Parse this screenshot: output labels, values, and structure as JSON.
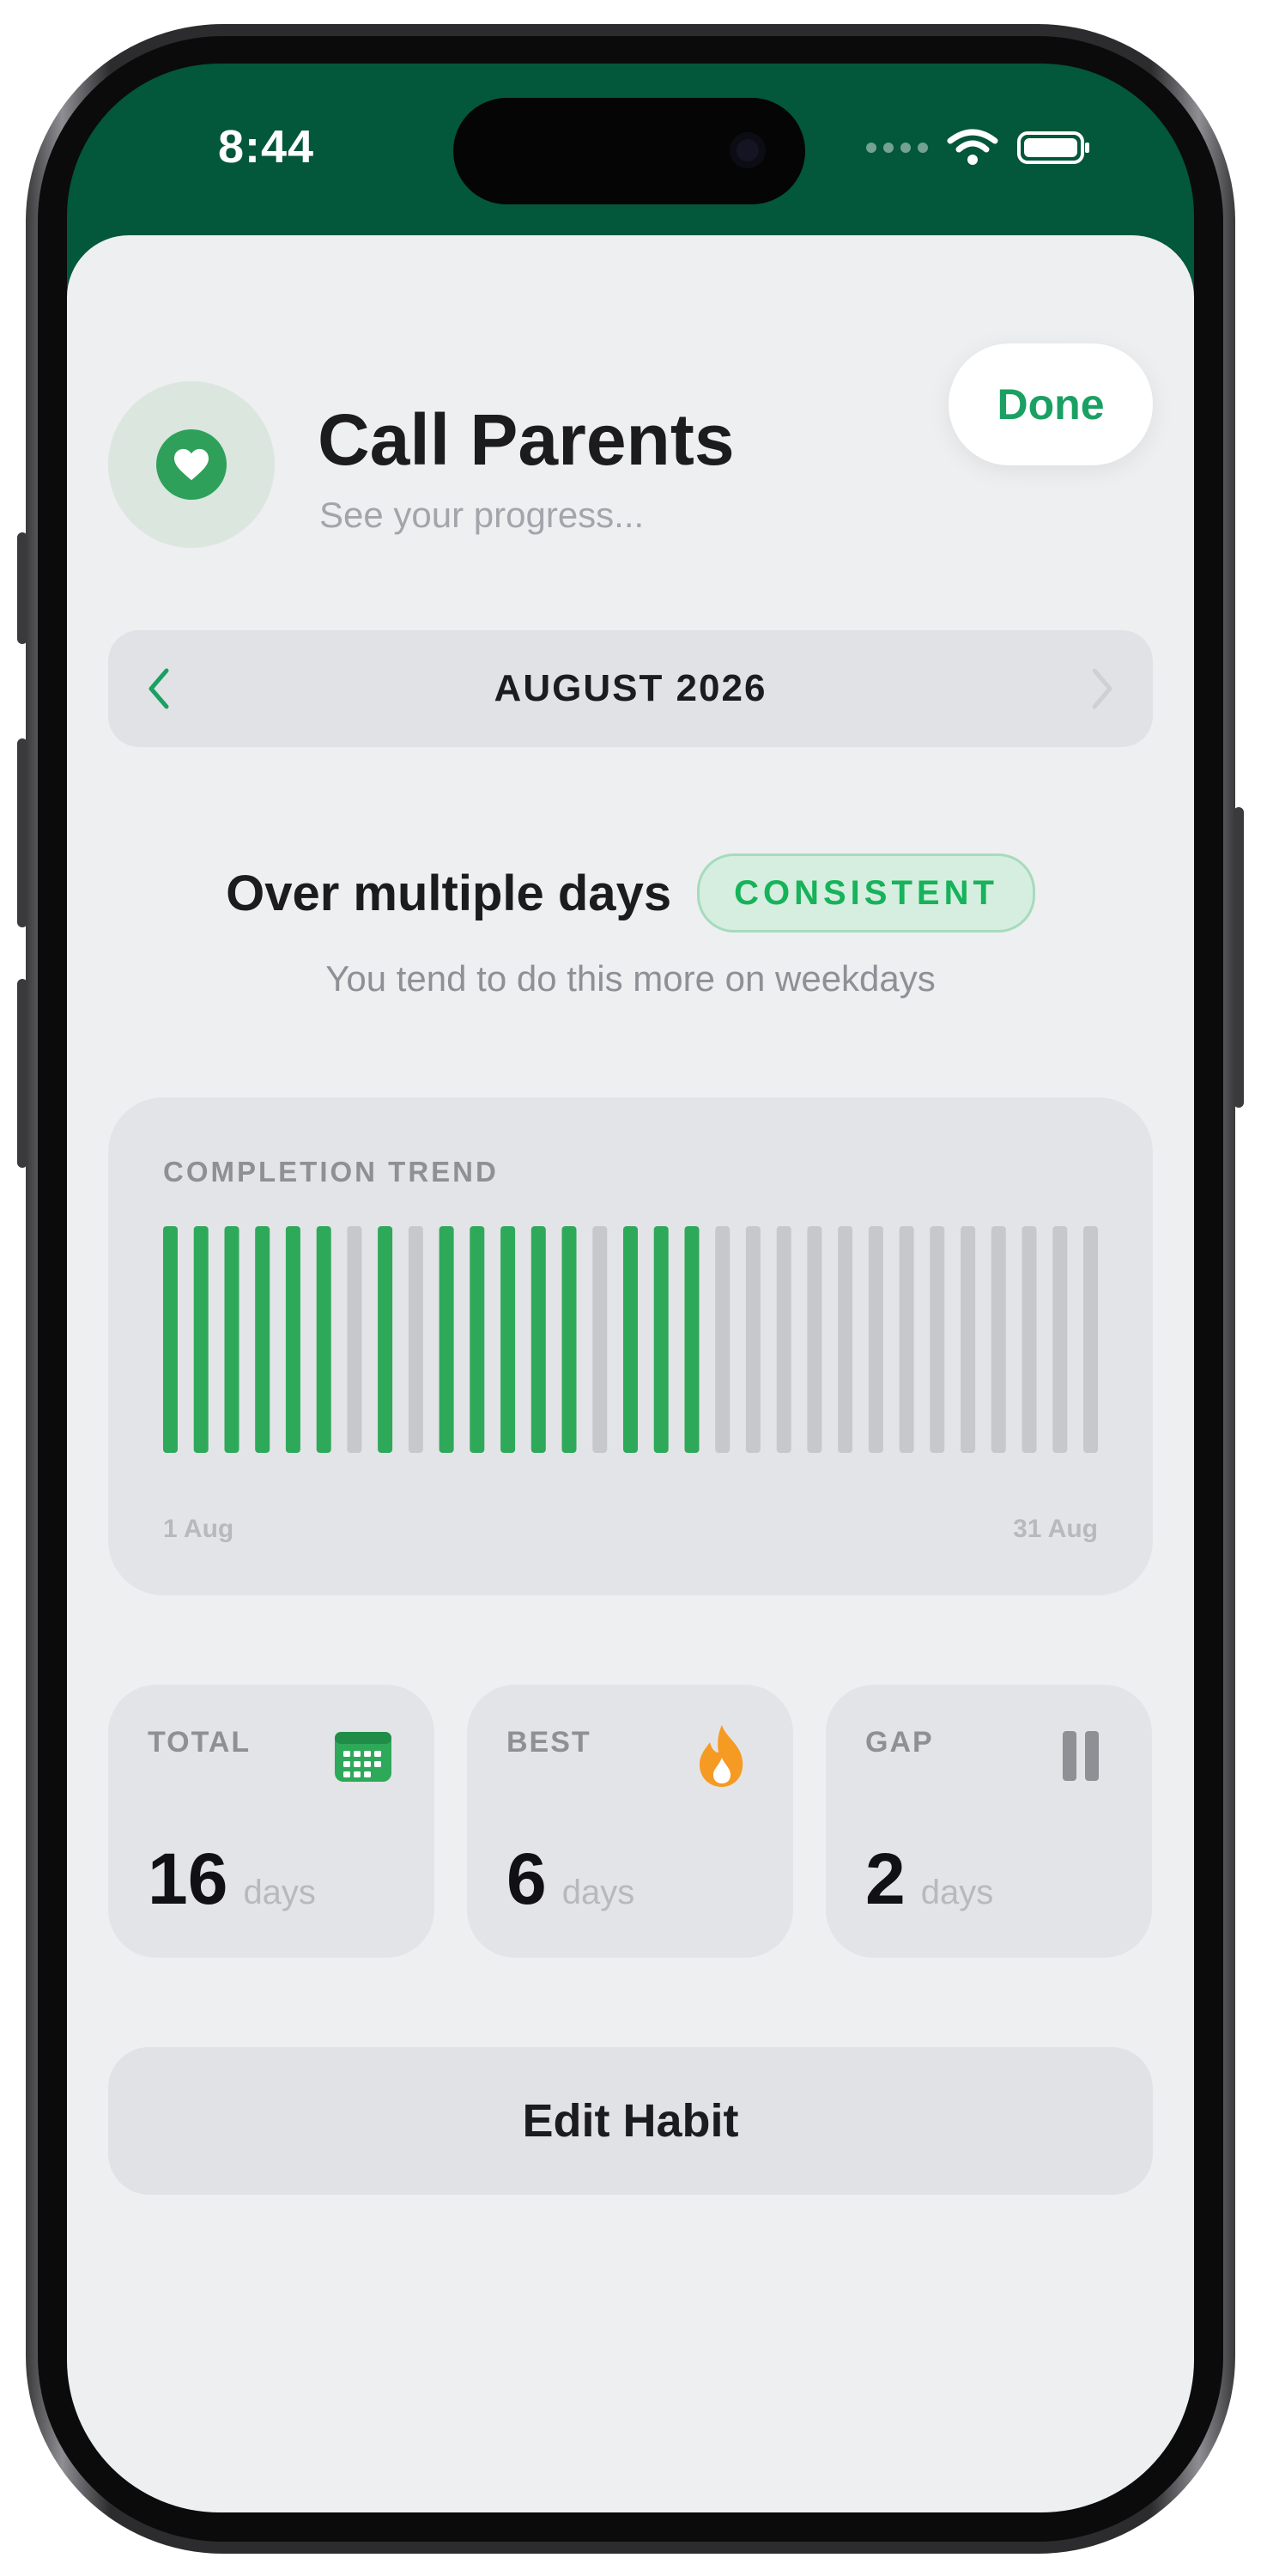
{
  "status_bar": {
    "time": "8:44"
  },
  "header": {
    "done_label": "Done",
    "title": "Call Parents",
    "subtitle": "See your progress..."
  },
  "month_nav": {
    "label": "AUGUST 2026"
  },
  "pattern": {
    "title": "Over multiple days",
    "badge": "CONSISTENT",
    "subtitle": "You tend to do this more on weekdays"
  },
  "trend": {
    "label": "COMPLETION TREND",
    "axis_start": "1 Aug",
    "axis_end": "31 Aug"
  },
  "chart_data": {
    "type": "bar",
    "categories": [
      "1",
      "2",
      "3",
      "4",
      "5",
      "6",
      "7",
      "8",
      "9",
      "10",
      "11",
      "12",
      "13",
      "14",
      "15",
      "16",
      "17",
      "18",
      "19",
      "20",
      "21",
      "22",
      "23",
      "24",
      "25",
      "26",
      "27",
      "28",
      "29",
      "30",
      "31"
    ],
    "values": [
      1,
      1,
      1,
      1,
      1,
      1,
      0,
      1,
      0,
      1,
      1,
      1,
      1,
      1,
      0,
      1,
      1,
      1,
      0,
      0,
      0,
      0,
      0,
      0,
      0,
      0,
      0,
      0,
      0,
      0,
      0
    ],
    "title": "COMPLETION TREND",
    "ylim": [
      0,
      1
    ],
    "colors": {
      "done": "#2ea95a",
      "missed": "#c7c8cc"
    }
  },
  "stats": [
    {
      "label": "TOTAL",
      "value": "16",
      "unit": "days",
      "icon": "calendar-icon"
    },
    {
      "label": "BEST",
      "value": "6",
      "unit": "days",
      "icon": "flame-icon"
    },
    {
      "label": "GAP",
      "value": "2",
      "unit": "days",
      "icon": "pause-icon"
    }
  ],
  "edit_label": "Edit Habit",
  "colors": {
    "header_green": "#03573a",
    "accent_green": "#1aa063",
    "bar_green": "#2ea95a",
    "flame_orange": "#f59a23"
  }
}
